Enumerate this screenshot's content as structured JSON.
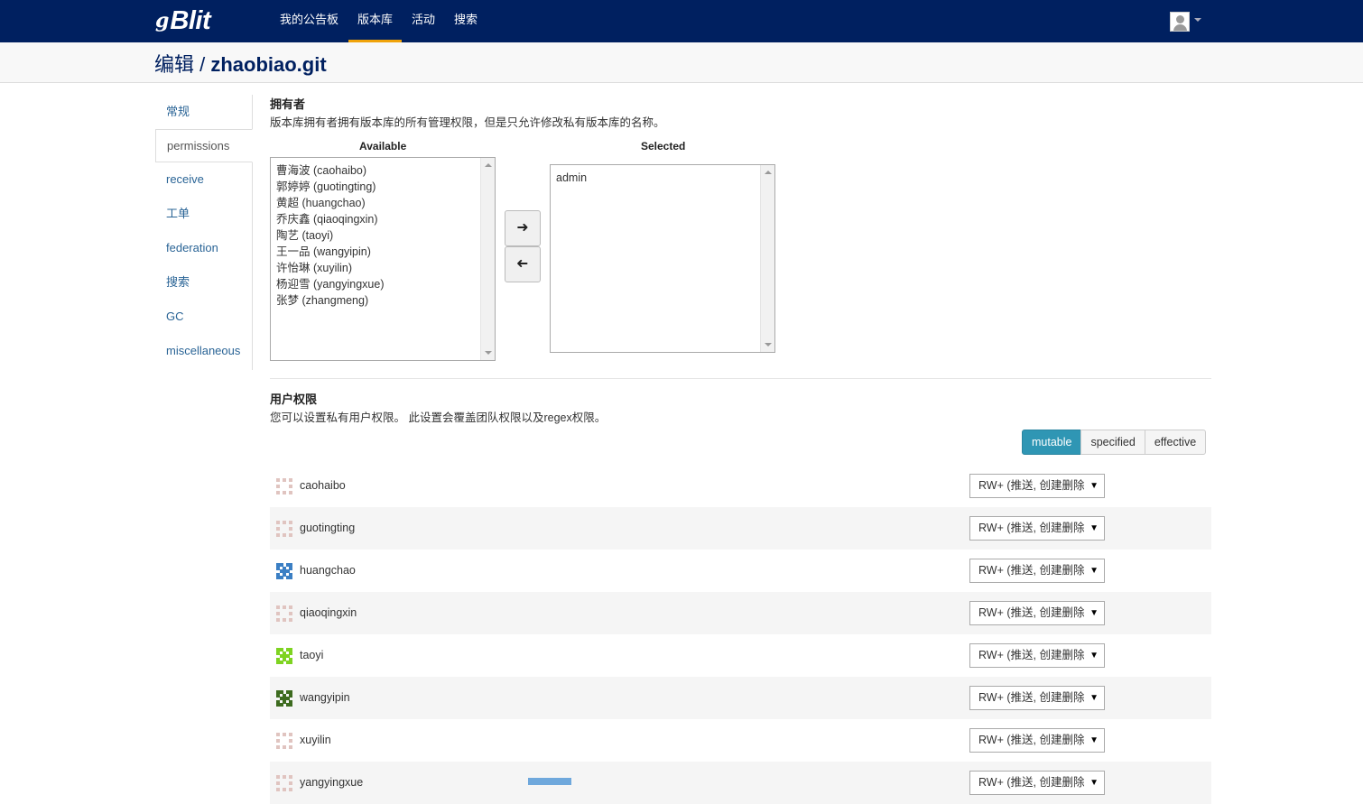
{
  "brand": {
    "prefix": "g",
    "name": "Blit"
  },
  "nav": {
    "items": [
      {
        "label": "我的公告板",
        "active": false
      },
      {
        "label": "版本库",
        "active": true
      },
      {
        "label": "活动",
        "active": false
      },
      {
        "label": "搜索",
        "active": false
      }
    ]
  },
  "header": {
    "action": "编辑 / ",
    "repo": "zhaobiao.git"
  },
  "sidebar": {
    "items": [
      {
        "label": "常规"
      },
      {
        "label": "permissions"
      },
      {
        "label": "receive"
      },
      {
        "label": "工单"
      },
      {
        "label": "federation"
      },
      {
        "label": "搜索"
      },
      {
        "label": "GC"
      },
      {
        "label": "miscellaneous"
      }
    ]
  },
  "owners": {
    "title": "拥有者",
    "description": "版本库拥有者拥有版本库的所有管理权限，但是只允许修改私有版本库的名称。",
    "available_label": "Available",
    "selected_label": "Selected",
    "available": [
      "曹海波 (caohaibo)",
      "郭婷婷 (guotingting)",
      "黄超 (huangchao)",
      "乔庆鑫 (qiaoqingxin)",
      "陶艺 (taoyi)",
      "王一品 (wangyipin)",
      "许怡琳 (xuyilin)",
      "杨迎雪 (yangyingxue)",
      "张梦 (zhangmeng)"
    ],
    "selected": [
      "admin"
    ]
  },
  "user_permissions": {
    "title": "用户权限",
    "description": "您可以设置私有用户权限。 此设置会覆盖团队权限以及regex权限。",
    "filters": [
      "mutable",
      "specified",
      "effective"
    ],
    "active_filter": "mutable",
    "rows": [
      {
        "user": "caohaibo",
        "permission": "RW+ (推送, 创建删除",
        "avatar_color": "#e0c4c0"
      },
      {
        "user": "guotingting",
        "permission": "RW+ (推送, 创建删除",
        "avatar_color": "#e0c4c0"
      },
      {
        "user": "huangchao",
        "permission": "RW+ (推送, 创建删除",
        "avatar_color": "#3b7fc4"
      },
      {
        "user": "qiaoqingxin",
        "permission": "RW+ (推送, 创建删除",
        "avatar_color": "#e0c4c0"
      },
      {
        "user": "taoyi",
        "permission": "RW+ (推送, 创建删除",
        "avatar_color": "#7ed321"
      },
      {
        "user": "wangyipin",
        "permission": "RW+ (推送, 创建删除",
        "avatar_color": "#3d6b1f"
      },
      {
        "user": "xuyilin",
        "permission": "RW+ (推送, 创建删除",
        "avatar_color": "#e0c4c0"
      },
      {
        "user": "yangyingxue",
        "permission": "RW+ (推送, 创建删除",
        "avatar_color": "#e0c4c0"
      }
    ]
  },
  "icons": {
    "move_right": "arrow-right-icon",
    "move_left": "arrow-left-icon",
    "dropdown_arrow": "▼"
  }
}
